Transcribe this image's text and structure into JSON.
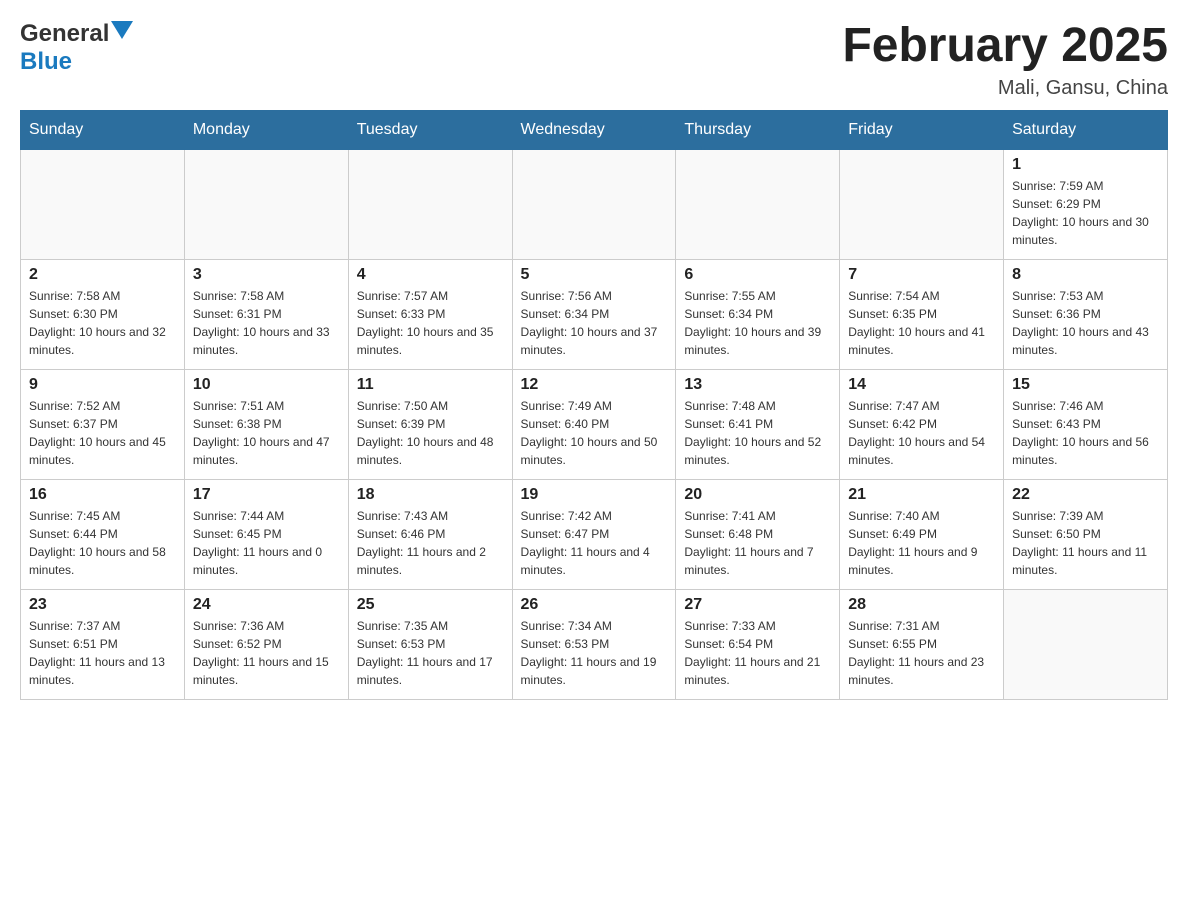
{
  "header": {
    "logo_general": "General",
    "logo_blue": "Blue",
    "title": "February 2025",
    "subtitle": "Mali, Gansu, China"
  },
  "weekdays": [
    "Sunday",
    "Monday",
    "Tuesday",
    "Wednesday",
    "Thursday",
    "Friday",
    "Saturday"
  ],
  "weeks": [
    [
      {
        "day": "",
        "info": ""
      },
      {
        "day": "",
        "info": ""
      },
      {
        "day": "",
        "info": ""
      },
      {
        "day": "",
        "info": ""
      },
      {
        "day": "",
        "info": ""
      },
      {
        "day": "",
        "info": ""
      },
      {
        "day": "1",
        "info": "Sunrise: 7:59 AM\nSunset: 6:29 PM\nDaylight: 10 hours and 30 minutes."
      }
    ],
    [
      {
        "day": "2",
        "info": "Sunrise: 7:58 AM\nSunset: 6:30 PM\nDaylight: 10 hours and 32 minutes."
      },
      {
        "day": "3",
        "info": "Sunrise: 7:58 AM\nSunset: 6:31 PM\nDaylight: 10 hours and 33 minutes."
      },
      {
        "day": "4",
        "info": "Sunrise: 7:57 AM\nSunset: 6:33 PM\nDaylight: 10 hours and 35 minutes."
      },
      {
        "day": "5",
        "info": "Sunrise: 7:56 AM\nSunset: 6:34 PM\nDaylight: 10 hours and 37 minutes."
      },
      {
        "day": "6",
        "info": "Sunrise: 7:55 AM\nSunset: 6:34 PM\nDaylight: 10 hours and 39 minutes."
      },
      {
        "day": "7",
        "info": "Sunrise: 7:54 AM\nSunset: 6:35 PM\nDaylight: 10 hours and 41 minutes."
      },
      {
        "day": "8",
        "info": "Sunrise: 7:53 AM\nSunset: 6:36 PM\nDaylight: 10 hours and 43 minutes."
      }
    ],
    [
      {
        "day": "9",
        "info": "Sunrise: 7:52 AM\nSunset: 6:37 PM\nDaylight: 10 hours and 45 minutes."
      },
      {
        "day": "10",
        "info": "Sunrise: 7:51 AM\nSunset: 6:38 PM\nDaylight: 10 hours and 47 minutes."
      },
      {
        "day": "11",
        "info": "Sunrise: 7:50 AM\nSunset: 6:39 PM\nDaylight: 10 hours and 48 minutes."
      },
      {
        "day": "12",
        "info": "Sunrise: 7:49 AM\nSunset: 6:40 PM\nDaylight: 10 hours and 50 minutes."
      },
      {
        "day": "13",
        "info": "Sunrise: 7:48 AM\nSunset: 6:41 PM\nDaylight: 10 hours and 52 minutes."
      },
      {
        "day": "14",
        "info": "Sunrise: 7:47 AM\nSunset: 6:42 PM\nDaylight: 10 hours and 54 minutes."
      },
      {
        "day": "15",
        "info": "Sunrise: 7:46 AM\nSunset: 6:43 PM\nDaylight: 10 hours and 56 minutes."
      }
    ],
    [
      {
        "day": "16",
        "info": "Sunrise: 7:45 AM\nSunset: 6:44 PM\nDaylight: 10 hours and 58 minutes."
      },
      {
        "day": "17",
        "info": "Sunrise: 7:44 AM\nSunset: 6:45 PM\nDaylight: 11 hours and 0 minutes."
      },
      {
        "day": "18",
        "info": "Sunrise: 7:43 AM\nSunset: 6:46 PM\nDaylight: 11 hours and 2 minutes."
      },
      {
        "day": "19",
        "info": "Sunrise: 7:42 AM\nSunset: 6:47 PM\nDaylight: 11 hours and 4 minutes."
      },
      {
        "day": "20",
        "info": "Sunrise: 7:41 AM\nSunset: 6:48 PM\nDaylight: 11 hours and 7 minutes."
      },
      {
        "day": "21",
        "info": "Sunrise: 7:40 AM\nSunset: 6:49 PM\nDaylight: 11 hours and 9 minutes."
      },
      {
        "day": "22",
        "info": "Sunrise: 7:39 AM\nSunset: 6:50 PM\nDaylight: 11 hours and 11 minutes."
      }
    ],
    [
      {
        "day": "23",
        "info": "Sunrise: 7:37 AM\nSunset: 6:51 PM\nDaylight: 11 hours and 13 minutes."
      },
      {
        "day": "24",
        "info": "Sunrise: 7:36 AM\nSunset: 6:52 PM\nDaylight: 11 hours and 15 minutes."
      },
      {
        "day": "25",
        "info": "Sunrise: 7:35 AM\nSunset: 6:53 PM\nDaylight: 11 hours and 17 minutes."
      },
      {
        "day": "26",
        "info": "Sunrise: 7:34 AM\nSunset: 6:53 PM\nDaylight: 11 hours and 19 minutes."
      },
      {
        "day": "27",
        "info": "Sunrise: 7:33 AM\nSunset: 6:54 PM\nDaylight: 11 hours and 21 minutes."
      },
      {
        "day": "28",
        "info": "Sunrise: 7:31 AM\nSunset: 6:55 PM\nDaylight: 11 hours and 23 minutes."
      },
      {
        "day": "",
        "info": ""
      }
    ]
  ]
}
